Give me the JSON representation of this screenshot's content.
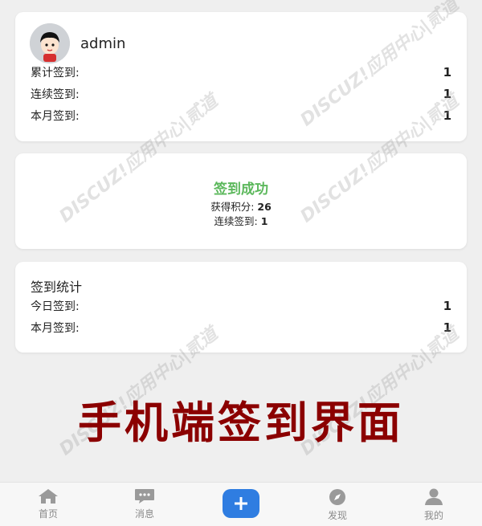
{
  "user": {
    "name": "admin",
    "stats": [
      {
        "label": "累计签到:",
        "value": "1"
      },
      {
        "label": "连续签到:",
        "value": "1"
      },
      {
        "label": "本月签到:",
        "value": "1"
      }
    ]
  },
  "result": {
    "title": "签到成功",
    "points_label": "获得积分:",
    "points_value": "26",
    "streak_label": "连续签到:",
    "streak_value": "1"
  },
  "stats": {
    "title": "签到统计",
    "rows": [
      {
        "label": "今日签到:",
        "value": "1"
      },
      {
        "label": "本月签到:",
        "value": "1"
      }
    ]
  },
  "banner": "手机端签到界面",
  "watermark": "DISCUZ!应用中心|贰道",
  "tabs": {
    "home": "首页",
    "messages": "消息",
    "discover": "发现",
    "mine": "我的"
  },
  "colors": {
    "success": "#5cb85c",
    "banner": "#8b0000",
    "plus": "#2f7de1"
  }
}
